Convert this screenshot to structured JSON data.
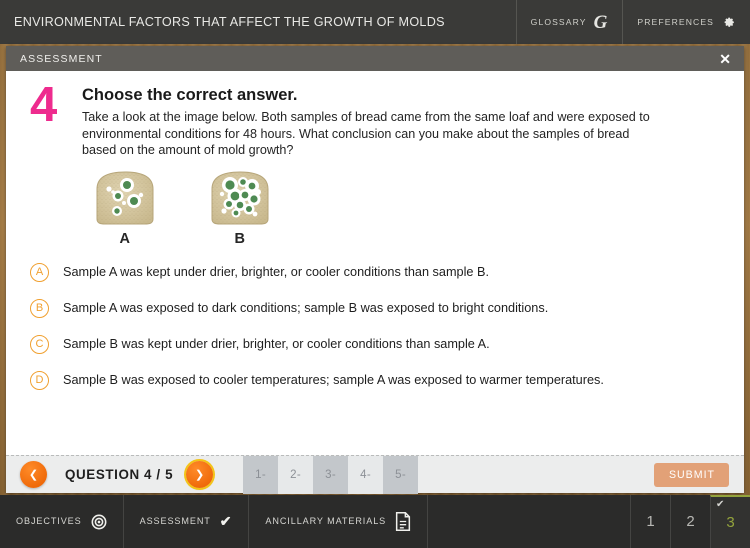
{
  "header": {
    "title": "ENVIRONMENTAL FACTORS THAT AFFECT THE GROWTH OF MOLDS",
    "glossary_label": "GLOSSARY",
    "glossary_icon": "glossary-g-icon",
    "preferences_label": "PREFERENCES",
    "preferences_icon": "gear-icon"
  },
  "modal": {
    "title": "ASSESSMENT",
    "close_icon": "close-x-icon"
  },
  "question": {
    "number": "4",
    "instruction": "Choose the correct answer.",
    "prompt": "Take a look at the image below. Both samples of bread came from the same loaf and were exposed to environmental conditions for 48 hours. What conclusion can you make about the samples of bread based on the amount of mold growth?",
    "figure": [
      {
        "label": "A",
        "alt": "bread-slice-with-few-mold-spots"
      },
      {
        "label": "B",
        "alt": "bread-slice-with-many-mold-spots"
      }
    ],
    "options": [
      {
        "key": "A",
        "text": "Sample A was kept under drier, brighter, or cooler conditions than sample B."
      },
      {
        "key": "B",
        "text": "Sample A was exposed to dark conditions; sample B was exposed to bright conditions."
      },
      {
        "key": "C",
        "text": "Sample B was kept under drier, brighter, or cooler conditions than sample A."
      },
      {
        "key": "D",
        "text": "Sample B was exposed to cooler temperatures; sample A was exposed to warmer temperatures."
      }
    ]
  },
  "nav": {
    "prev_icon": "chevron-left-icon",
    "next_icon": "chevron-right-icon",
    "question_label": "QUESTION 4 / 5",
    "tabs": [
      {
        "label": "1-",
        "shade": "dark"
      },
      {
        "label": "2-",
        "shade": "light"
      },
      {
        "label": "3-",
        "shade": "dark"
      },
      {
        "label": "4-",
        "shade": "light"
      },
      {
        "label": "5-",
        "shade": "dark"
      }
    ],
    "submit_label": "SUBMIT"
  },
  "bottom": {
    "items": [
      {
        "label": "OBJECTIVES",
        "icon": "target-icon"
      },
      {
        "label": "ASSESSMENT",
        "icon": "check-icon"
      },
      {
        "label": "ANCILLARY MATERIALS",
        "icon": "document-icon"
      }
    ],
    "pages": [
      {
        "label": "1",
        "active": false
      },
      {
        "label": "2",
        "active": false
      },
      {
        "label": "3",
        "active": true,
        "check": "✔"
      }
    ]
  },
  "colors": {
    "accent_pink": "#ee2b8e",
    "accent_orange": "#ef6a0a",
    "bubble_orange": "#f0a030",
    "active_green": "#93a33c",
    "wood": "#a97f48",
    "header_dark": "#3a3a38"
  }
}
